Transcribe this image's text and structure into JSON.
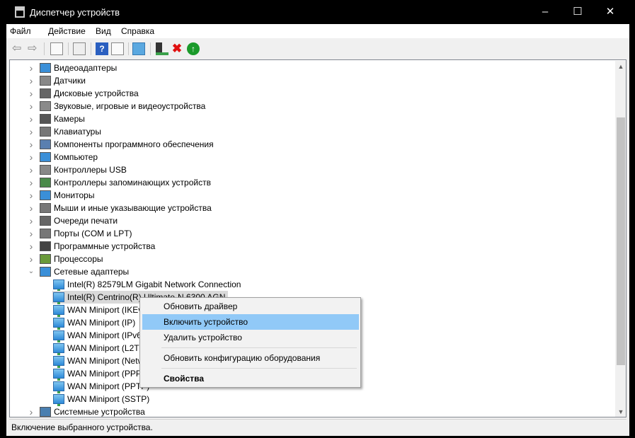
{
  "window": {
    "title": "Диспетчер устройств",
    "minimize": "–",
    "maximize": "☐",
    "close": "✕"
  },
  "menu": [
    "Файл",
    "Действие",
    "Вид",
    "Справка"
  ],
  "toolbar": [
    "back-icon",
    "forward-icon",
    "show-hide-tree-icon",
    "properties-icon",
    "help-icon",
    "action-pane-icon",
    "scan-hardware-icon",
    "update-driver-icon",
    "uninstall-icon",
    "enable-device-icon"
  ],
  "tree": {
    "categories_top": [
      "Видеоадаптеры",
      "Датчики",
      "Дисковые устройства",
      "Звуковые, игровые и видеоустройства",
      "Камеры",
      "Клавиатуры",
      "Компоненты программного обеспечения",
      "Компьютер",
      "Контроллеры USB",
      "Контроллеры запоминающих устройств",
      "Мониторы",
      "Мыши и иные указывающие устройства",
      "Очереди печати",
      "Порты (COM и LPT)",
      "Программные устройства",
      "Процессоры"
    ],
    "expanded": {
      "label": "Сетевые адаптеры",
      "children": [
        "Intel(R) 82579LM Gigabit Network Connection",
        "Intel(R) Centrino(R) Ultimate-N 6300 AGN",
        "WAN Miniport (IKEv2)",
        "WAN Miniport (IP)",
        "WAN Miniport (IPv6)",
        "WAN Miniport (L2TP)",
        "WAN Miniport (Network Monitor)",
        "WAN Miniport (PPPOE)",
        "WAN Miniport (PPTP)",
        "WAN Miniport (SSTP)"
      ]
    },
    "categories_bottom": [
      "Системные устройства"
    ]
  },
  "context_menu": {
    "update_driver": "Обновить драйвер",
    "enable_device": "Включить устройство",
    "uninstall_device": "Удалить устройство",
    "scan_hardware": "Обновить конфигурацию оборудования",
    "properties": "Свойства"
  },
  "status": "Включение выбранного устройства."
}
